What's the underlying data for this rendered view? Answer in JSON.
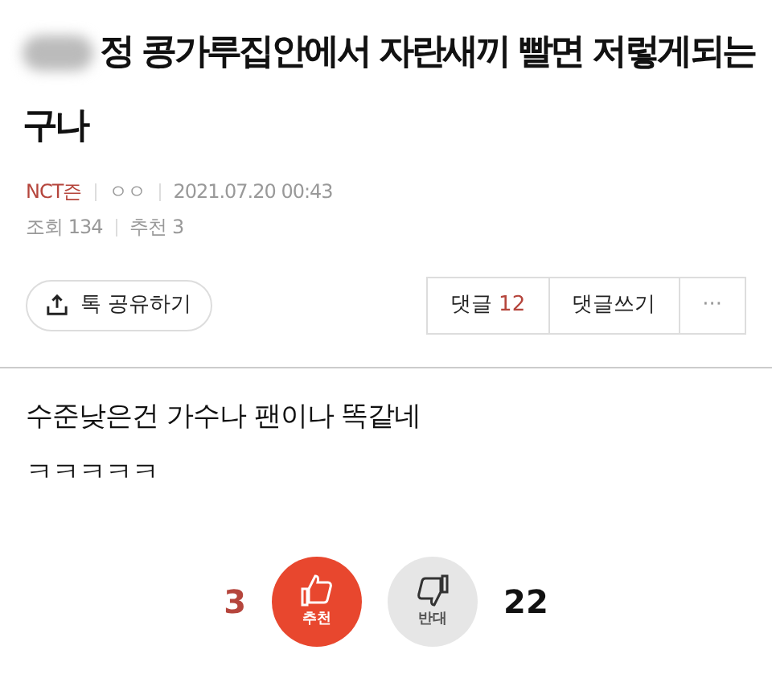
{
  "post": {
    "title": "정 콩가루집안에서 자란새끼 빨면 저렇게되는 구나",
    "author": "NCT즌",
    "nickname": "ㅇㅇ",
    "date": "2021.07.20 00:43",
    "views": "조회 134",
    "recommends": "추천 3"
  },
  "actions": {
    "share": "톡 공유하기",
    "comments_label": "댓글",
    "comments_count": "12",
    "write_comment": "댓글쓰기",
    "more": "···"
  },
  "body": [
    "수준낮은건 가수나 팬이나 똑같네",
    "ㅋㅋㅋㅋㅋ"
  ],
  "votes": {
    "up_count": "3",
    "up_label": "추천",
    "down_label": "반대",
    "down_count": "22"
  }
}
